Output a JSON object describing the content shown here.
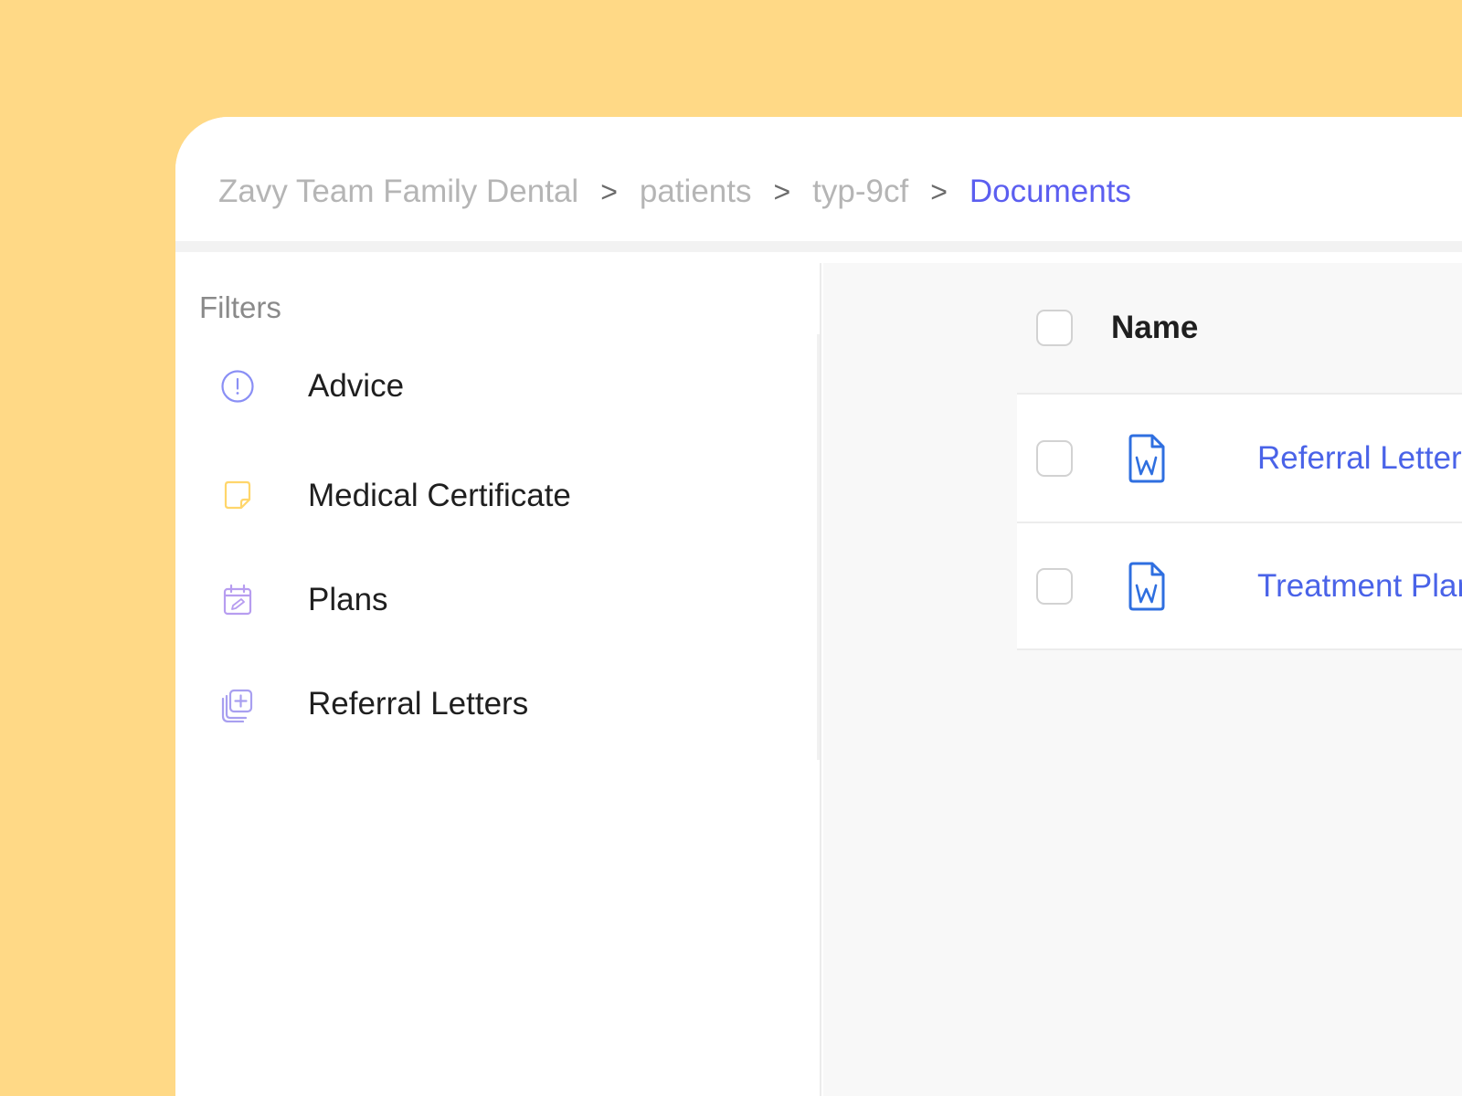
{
  "breadcrumb": {
    "items": [
      {
        "label": "Zavy Team Family Dental"
      },
      {
        "label": "patients"
      },
      {
        "label": "typ-9cf"
      },
      {
        "label": "Documents"
      }
    ],
    "separator": ">"
  },
  "sidebar": {
    "title": "Filters",
    "items": [
      {
        "label": "Advice",
        "icon": "alert-circle-icon",
        "color": "#8a8ff5"
      },
      {
        "label": "Medical Certificate",
        "icon": "sticky-note-icon",
        "color": "#ffd66b"
      },
      {
        "label": "Plans",
        "icon": "calendar-edit-icon",
        "color": "#b79df0"
      },
      {
        "label": "Referral Letters",
        "icon": "copy-plus-icon",
        "color": "#a89ff0"
      }
    ]
  },
  "table": {
    "header": {
      "name": "Name"
    },
    "rows": [
      {
        "name": "Referral Letter - Aaron T",
        "icon": "word-document-icon"
      },
      {
        "name": "Treatment Plan - Aaron T",
        "icon": "word-document-icon"
      }
    ]
  },
  "colors": {
    "background": "#FFD986",
    "accent": "#5b5ef0",
    "link": "#4a63e8",
    "word_icon": "#2f6fe0"
  }
}
